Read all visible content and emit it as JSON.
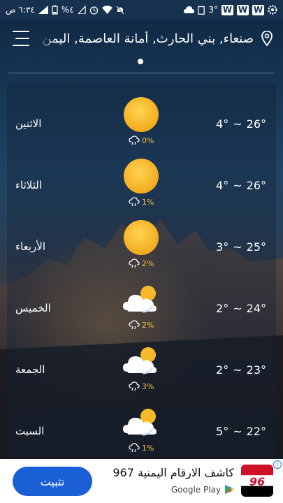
{
  "status_bar": {
    "time": "٦:٣٤ ص",
    "battery": "%٤",
    "network_number": "3°"
  },
  "header": {
    "location": "صنعاء, بني الحارث, أمانة العاصمة, اليمن"
  },
  "forecast": [
    {
      "day": "الاثنين",
      "condition": "sunny",
      "precip": "0%",
      "high": "26°",
      "low": "4°"
    },
    {
      "day": "الثلاثاء",
      "condition": "sunny",
      "precip": "1%",
      "high": "26°",
      "low": "4°"
    },
    {
      "day": "الأربعاء",
      "condition": "sunny",
      "precip": "2%",
      "high": "25°",
      "low": "3°"
    },
    {
      "day": "الخميس",
      "condition": "partly-cloudy",
      "precip": "2%",
      "high": "24°",
      "low": "2°"
    },
    {
      "day": "الجمعة",
      "condition": "partly-cloudy",
      "precip": "3%",
      "high": "23°",
      "low": "2°"
    },
    {
      "day": "السبت",
      "condition": "partly-cloudy",
      "precip": "1%",
      "high": "22°",
      "low": "5°"
    }
  ],
  "temp_separator": "~",
  "ad": {
    "install_label": "تثبيت",
    "app_title": "كاشف الارقام اليمنية 967",
    "store_label": "Google Play",
    "logo_text": "96"
  },
  "colors": {
    "accent_sun": "#f6b92b",
    "precip_text": "#f0c23a",
    "install_button": "#1a5fd6"
  }
}
